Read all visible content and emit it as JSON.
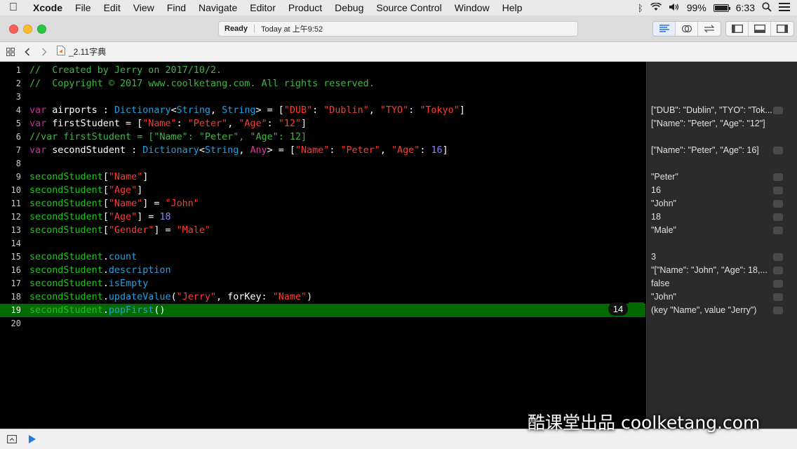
{
  "menubar": {
    "app": "Xcode",
    "items": [
      "File",
      "Edit",
      "View",
      "Find",
      "Navigate",
      "Editor",
      "Product",
      "Debug",
      "Source Control",
      "Window",
      "Help"
    ],
    "battery": "99%",
    "time": "6:33"
  },
  "toolbar": {
    "status_title": "Ready",
    "status_time": "Today at 上午9:52"
  },
  "jumpbar": {
    "file": "_2.11字典"
  },
  "code": [
    {
      "n": "1",
      "tokens": [
        {
          "t": "//  Created by Jerry on 2017/10/2.",
          "c": "c-com"
        }
      ]
    },
    {
      "n": "2",
      "tokens": [
        {
          "t": "//  Copyright © 2017 www.coolketang.com. All rights reserved.",
          "c": "c-com"
        }
      ]
    },
    {
      "n": "3",
      "tokens": []
    },
    {
      "n": "4",
      "tokens": [
        {
          "t": "var",
          "c": "c-kw"
        },
        {
          "t": " airports : ",
          "c": "c-plain"
        },
        {
          "t": "Dictionary",
          "c": "c-type"
        },
        {
          "t": "<",
          "c": "c-plain"
        },
        {
          "t": "String",
          "c": "c-type"
        },
        {
          "t": ", ",
          "c": "c-plain"
        },
        {
          "t": "String",
          "c": "c-type"
        },
        {
          "t": "> = [",
          "c": "c-plain"
        },
        {
          "t": "\"DUB\"",
          "c": "c-str"
        },
        {
          "t": ": ",
          "c": "c-plain"
        },
        {
          "t": "\"Dublin\"",
          "c": "c-str"
        },
        {
          "t": ", ",
          "c": "c-plain"
        },
        {
          "t": "\"TYO\"",
          "c": "c-str"
        },
        {
          "t": ": ",
          "c": "c-plain"
        },
        {
          "t": "\"Tokyo\"",
          "c": "c-str"
        },
        {
          "t": "]",
          "c": "c-plain"
        }
      ]
    },
    {
      "n": "5",
      "tokens": [
        {
          "t": "var",
          "c": "c-kw"
        },
        {
          "t": " firstStudent = [",
          "c": "c-plain"
        },
        {
          "t": "\"Name\"",
          "c": "c-str"
        },
        {
          "t": ": ",
          "c": "c-plain"
        },
        {
          "t": "\"Peter\"",
          "c": "c-str"
        },
        {
          "t": ", ",
          "c": "c-plain"
        },
        {
          "t": "\"Age\"",
          "c": "c-str"
        },
        {
          "t": ": ",
          "c": "c-plain"
        },
        {
          "t": "\"12\"",
          "c": "c-str"
        },
        {
          "t": "]",
          "c": "c-plain"
        }
      ]
    },
    {
      "n": "6",
      "tokens": [
        {
          "t": "//var firstStudent = [\"Name\": \"Peter\", \"Age\": 12]",
          "c": "c-com"
        }
      ]
    },
    {
      "n": "7",
      "tokens": [
        {
          "t": "var",
          "c": "c-kw"
        },
        {
          "t": " secondStudent : ",
          "c": "c-plain"
        },
        {
          "t": "Dictionary",
          "c": "c-type"
        },
        {
          "t": "<",
          "c": "c-plain"
        },
        {
          "t": "String",
          "c": "c-type"
        },
        {
          "t": ", ",
          "c": "c-plain"
        },
        {
          "t": "Any",
          "c": "c-kw2"
        },
        {
          "t": "> = [",
          "c": "c-plain"
        },
        {
          "t": "\"Name\"",
          "c": "c-str"
        },
        {
          "t": ": ",
          "c": "c-plain"
        },
        {
          "t": "\"Peter\"",
          "c": "c-str"
        },
        {
          "t": ", ",
          "c": "c-plain"
        },
        {
          "t": "\"Age\"",
          "c": "c-str"
        },
        {
          "t": ": ",
          "c": "c-plain"
        },
        {
          "t": "16",
          "c": "c-num"
        },
        {
          "t": "]",
          "c": "c-plain"
        }
      ]
    },
    {
      "n": "8",
      "tokens": []
    },
    {
      "n": "9",
      "tokens": [
        {
          "t": "secondStudent",
          "c": "c-var"
        },
        {
          "t": "[",
          "c": "c-plain"
        },
        {
          "t": "\"Name\"",
          "c": "c-str"
        },
        {
          "t": "]",
          "c": "c-plain"
        }
      ]
    },
    {
      "n": "10",
      "tokens": [
        {
          "t": "secondStudent",
          "c": "c-var"
        },
        {
          "t": "[",
          "c": "c-plain"
        },
        {
          "t": "\"Age\"",
          "c": "c-str"
        },
        {
          "t": "]",
          "c": "c-plain"
        }
      ]
    },
    {
      "n": "11",
      "tokens": [
        {
          "t": "secondStudent",
          "c": "c-var"
        },
        {
          "t": "[",
          "c": "c-plain"
        },
        {
          "t": "\"Name\"",
          "c": "c-str"
        },
        {
          "t": "] = ",
          "c": "c-plain"
        },
        {
          "t": "\"John\"",
          "c": "c-str"
        }
      ]
    },
    {
      "n": "12",
      "tokens": [
        {
          "t": "secondStudent",
          "c": "c-var"
        },
        {
          "t": "[",
          "c": "c-plain"
        },
        {
          "t": "\"Age\"",
          "c": "c-str"
        },
        {
          "t": "] = ",
          "c": "c-plain"
        },
        {
          "t": "18",
          "c": "c-num"
        }
      ]
    },
    {
      "n": "13",
      "tokens": [
        {
          "t": "secondStudent",
          "c": "c-var"
        },
        {
          "t": "[",
          "c": "c-plain"
        },
        {
          "t": "\"Gender\"",
          "c": "c-str"
        },
        {
          "t": "] = ",
          "c": "c-plain"
        },
        {
          "t": "\"Male\"",
          "c": "c-str"
        }
      ]
    },
    {
      "n": "14",
      "tokens": []
    },
    {
      "n": "15",
      "tokens": [
        {
          "t": "secondStudent",
          "c": "c-var"
        },
        {
          "t": ".",
          "c": "c-plain"
        },
        {
          "t": "count",
          "c": "c-prop"
        }
      ]
    },
    {
      "n": "16",
      "tokens": [
        {
          "t": "secondStudent",
          "c": "c-var"
        },
        {
          "t": ".",
          "c": "c-plain"
        },
        {
          "t": "description",
          "c": "c-prop"
        }
      ]
    },
    {
      "n": "17",
      "tokens": [
        {
          "t": "secondStudent",
          "c": "c-var"
        },
        {
          "t": ".",
          "c": "c-plain"
        },
        {
          "t": "isEmpty",
          "c": "c-prop"
        }
      ]
    },
    {
      "n": "18",
      "tokens": [
        {
          "t": "secondStudent",
          "c": "c-var"
        },
        {
          "t": ".",
          "c": "c-plain"
        },
        {
          "t": "updateValue",
          "c": "c-prop"
        },
        {
          "t": "(",
          "c": "c-plain"
        },
        {
          "t": "\"Jerry\"",
          "c": "c-str"
        },
        {
          "t": ", forKey: ",
          "c": "c-plain"
        },
        {
          "t": "\"Name\"",
          "c": "c-str"
        },
        {
          "t": ")",
          "c": "c-plain"
        }
      ]
    },
    {
      "n": "19",
      "current": true,
      "tokens": [
        {
          "t": "secondStudent",
          "c": "c-var"
        },
        {
          "t": ".",
          "c": "c-plain"
        },
        {
          "t": "popFirst",
          "c": "c-prop"
        },
        {
          "t": "()",
          "c": "c-plain"
        }
      ]
    },
    {
      "n": "20",
      "tokens": []
    }
  ],
  "current_column_badge": "14",
  "results": [
    {
      "line": 4,
      "text": "[\"DUB\": \"Dublin\", \"TYO\": \"Tok...",
      "qlook": true
    },
    {
      "line": 5,
      "text": "[\"Name\": \"Peter\", \"Age\": \"12\"]",
      "qlook": false
    },
    {
      "line": 7,
      "text": "[\"Name\": \"Peter\", \"Age\": 16]",
      "qlook": true
    },
    {
      "line": 9,
      "text": "\"Peter\"",
      "qlook": true
    },
    {
      "line": 10,
      "text": "16",
      "qlook": true
    },
    {
      "line": 11,
      "text": "\"John\"",
      "qlook": true
    },
    {
      "line": 12,
      "text": "18",
      "qlook": true
    },
    {
      "line": 13,
      "text": "\"Male\"",
      "qlook": true
    },
    {
      "line": 15,
      "text": "3",
      "qlook": true
    },
    {
      "line": 16,
      "text": "\"[\"Name\": \"John\", \"Age\": 18,...",
      "qlook": true
    },
    {
      "line": 17,
      "text": "false",
      "qlook": true
    },
    {
      "line": 18,
      "text": "\"John\"",
      "qlook": true
    },
    {
      "line": 19,
      "text": "(key \"Name\", value \"Jerry\")",
      "qlook": true
    }
  ],
  "watermark": "酷课堂出品 coolketang.com",
  "colors": {
    "current_line": "#006a00",
    "editor_bg": "#000000",
    "results_bg": "#2b2b2b"
  }
}
